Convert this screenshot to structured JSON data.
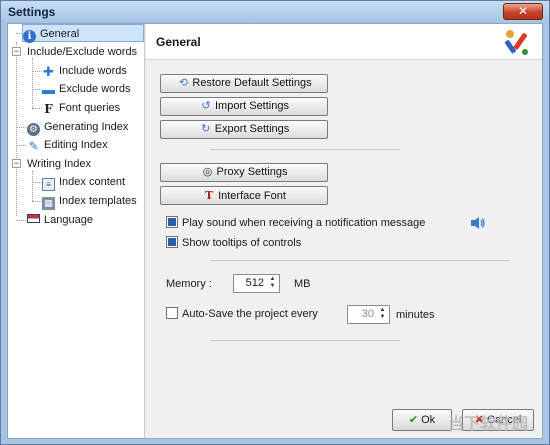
{
  "window": {
    "title": "Settings"
  },
  "tree": {
    "items": [
      {
        "label": "General",
        "icon": "info-icon"
      },
      {
        "label": "Include/Exclude words"
      },
      {
        "label": "Include words",
        "icon": "plus-icon"
      },
      {
        "label": "Exclude words",
        "icon": "minus-icon"
      },
      {
        "label": "Font queries",
        "icon": "font-icon"
      },
      {
        "label": "Generating Index",
        "icon": "gear-icon"
      },
      {
        "label": "Editing Index",
        "icon": "pencil-icon"
      },
      {
        "label": "Writing Index"
      },
      {
        "label": "Index content",
        "icon": "document-icon"
      },
      {
        "label": "Index templates",
        "icon": "template-icon"
      },
      {
        "label": "Language",
        "icon": "flag-icon"
      }
    ]
  },
  "panel": {
    "title": "General",
    "buttons": {
      "restore": "Restore Default Settings",
      "import": "Import Settings",
      "export": "Export Settings",
      "proxy": "Proxy Settings",
      "font": "Interface Font"
    },
    "checkboxes": {
      "play_sound": {
        "label": "Play sound when receiving a notification message",
        "checked": true
      },
      "tooltips": {
        "label": "Show tooltips of controls",
        "checked": true
      },
      "autosave": {
        "label": "Auto-Save the project every",
        "checked": false
      }
    },
    "memory": {
      "label": "Memory :",
      "value": "512",
      "unit": "MB"
    },
    "autosave": {
      "value": "30",
      "unit": "minutes"
    }
  },
  "footer": {
    "ok": "Ok",
    "cancel": "Cancel"
  },
  "watermark": "当下软件园",
  "colors": {
    "accent": "#2c5ea8",
    "selection": "#cfe3fb",
    "close": "#c8432a"
  }
}
